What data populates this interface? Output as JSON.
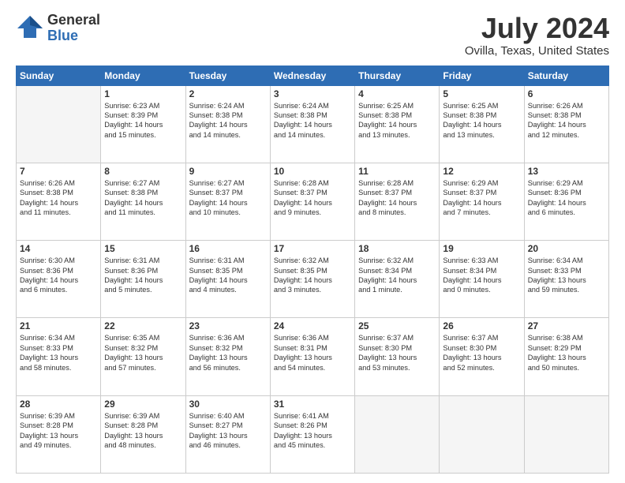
{
  "header": {
    "logo_general": "General",
    "logo_blue": "Blue",
    "title": "July 2024",
    "subtitle": "Ovilla, Texas, United States"
  },
  "weekdays": [
    "Sunday",
    "Monday",
    "Tuesday",
    "Wednesday",
    "Thursday",
    "Friday",
    "Saturday"
  ],
  "weeks": [
    [
      {
        "day": "",
        "lines": []
      },
      {
        "day": "1",
        "lines": [
          "Sunrise: 6:23 AM",
          "Sunset: 8:39 PM",
          "Daylight: 14 hours",
          "and 15 minutes."
        ]
      },
      {
        "day": "2",
        "lines": [
          "Sunrise: 6:24 AM",
          "Sunset: 8:38 PM",
          "Daylight: 14 hours",
          "and 14 minutes."
        ]
      },
      {
        "day": "3",
        "lines": [
          "Sunrise: 6:24 AM",
          "Sunset: 8:38 PM",
          "Daylight: 14 hours",
          "and 14 minutes."
        ]
      },
      {
        "day": "4",
        "lines": [
          "Sunrise: 6:25 AM",
          "Sunset: 8:38 PM",
          "Daylight: 14 hours",
          "and 13 minutes."
        ]
      },
      {
        "day": "5",
        "lines": [
          "Sunrise: 6:25 AM",
          "Sunset: 8:38 PM",
          "Daylight: 14 hours",
          "and 13 minutes."
        ]
      },
      {
        "day": "6",
        "lines": [
          "Sunrise: 6:26 AM",
          "Sunset: 8:38 PM",
          "Daylight: 14 hours",
          "and 12 minutes."
        ]
      }
    ],
    [
      {
        "day": "7",
        "lines": [
          "Sunrise: 6:26 AM",
          "Sunset: 8:38 PM",
          "Daylight: 14 hours",
          "and 11 minutes."
        ]
      },
      {
        "day": "8",
        "lines": [
          "Sunrise: 6:27 AM",
          "Sunset: 8:38 PM",
          "Daylight: 14 hours",
          "and 11 minutes."
        ]
      },
      {
        "day": "9",
        "lines": [
          "Sunrise: 6:27 AM",
          "Sunset: 8:37 PM",
          "Daylight: 14 hours",
          "and 10 minutes."
        ]
      },
      {
        "day": "10",
        "lines": [
          "Sunrise: 6:28 AM",
          "Sunset: 8:37 PM",
          "Daylight: 14 hours",
          "and 9 minutes."
        ]
      },
      {
        "day": "11",
        "lines": [
          "Sunrise: 6:28 AM",
          "Sunset: 8:37 PM",
          "Daylight: 14 hours",
          "and 8 minutes."
        ]
      },
      {
        "day": "12",
        "lines": [
          "Sunrise: 6:29 AM",
          "Sunset: 8:37 PM",
          "Daylight: 14 hours",
          "and 7 minutes."
        ]
      },
      {
        "day": "13",
        "lines": [
          "Sunrise: 6:29 AM",
          "Sunset: 8:36 PM",
          "Daylight: 14 hours",
          "and 6 minutes."
        ]
      }
    ],
    [
      {
        "day": "14",
        "lines": [
          "Sunrise: 6:30 AM",
          "Sunset: 8:36 PM",
          "Daylight: 14 hours",
          "and 6 minutes."
        ]
      },
      {
        "day": "15",
        "lines": [
          "Sunrise: 6:31 AM",
          "Sunset: 8:36 PM",
          "Daylight: 14 hours",
          "and 5 minutes."
        ]
      },
      {
        "day": "16",
        "lines": [
          "Sunrise: 6:31 AM",
          "Sunset: 8:35 PM",
          "Daylight: 14 hours",
          "and 4 minutes."
        ]
      },
      {
        "day": "17",
        "lines": [
          "Sunrise: 6:32 AM",
          "Sunset: 8:35 PM",
          "Daylight: 14 hours",
          "and 3 minutes."
        ]
      },
      {
        "day": "18",
        "lines": [
          "Sunrise: 6:32 AM",
          "Sunset: 8:34 PM",
          "Daylight: 14 hours",
          "and 1 minute."
        ]
      },
      {
        "day": "19",
        "lines": [
          "Sunrise: 6:33 AM",
          "Sunset: 8:34 PM",
          "Daylight: 14 hours",
          "and 0 minutes."
        ]
      },
      {
        "day": "20",
        "lines": [
          "Sunrise: 6:34 AM",
          "Sunset: 8:33 PM",
          "Daylight: 13 hours",
          "and 59 minutes."
        ]
      }
    ],
    [
      {
        "day": "21",
        "lines": [
          "Sunrise: 6:34 AM",
          "Sunset: 8:33 PM",
          "Daylight: 13 hours",
          "and 58 minutes."
        ]
      },
      {
        "day": "22",
        "lines": [
          "Sunrise: 6:35 AM",
          "Sunset: 8:32 PM",
          "Daylight: 13 hours",
          "and 57 minutes."
        ]
      },
      {
        "day": "23",
        "lines": [
          "Sunrise: 6:36 AM",
          "Sunset: 8:32 PM",
          "Daylight: 13 hours",
          "and 56 minutes."
        ]
      },
      {
        "day": "24",
        "lines": [
          "Sunrise: 6:36 AM",
          "Sunset: 8:31 PM",
          "Daylight: 13 hours",
          "and 54 minutes."
        ]
      },
      {
        "day": "25",
        "lines": [
          "Sunrise: 6:37 AM",
          "Sunset: 8:30 PM",
          "Daylight: 13 hours",
          "and 53 minutes."
        ]
      },
      {
        "day": "26",
        "lines": [
          "Sunrise: 6:37 AM",
          "Sunset: 8:30 PM",
          "Daylight: 13 hours",
          "and 52 minutes."
        ]
      },
      {
        "day": "27",
        "lines": [
          "Sunrise: 6:38 AM",
          "Sunset: 8:29 PM",
          "Daylight: 13 hours",
          "and 50 minutes."
        ]
      }
    ],
    [
      {
        "day": "28",
        "lines": [
          "Sunrise: 6:39 AM",
          "Sunset: 8:28 PM",
          "Daylight: 13 hours",
          "and 49 minutes."
        ]
      },
      {
        "day": "29",
        "lines": [
          "Sunrise: 6:39 AM",
          "Sunset: 8:28 PM",
          "Daylight: 13 hours",
          "and 48 minutes."
        ]
      },
      {
        "day": "30",
        "lines": [
          "Sunrise: 6:40 AM",
          "Sunset: 8:27 PM",
          "Daylight: 13 hours",
          "and 46 minutes."
        ]
      },
      {
        "day": "31",
        "lines": [
          "Sunrise: 6:41 AM",
          "Sunset: 8:26 PM",
          "Daylight: 13 hours",
          "and 45 minutes."
        ]
      },
      {
        "day": "",
        "lines": []
      },
      {
        "day": "",
        "lines": []
      },
      {
        "day": "",
        "lines": []
      }
    ]
  ]
}
